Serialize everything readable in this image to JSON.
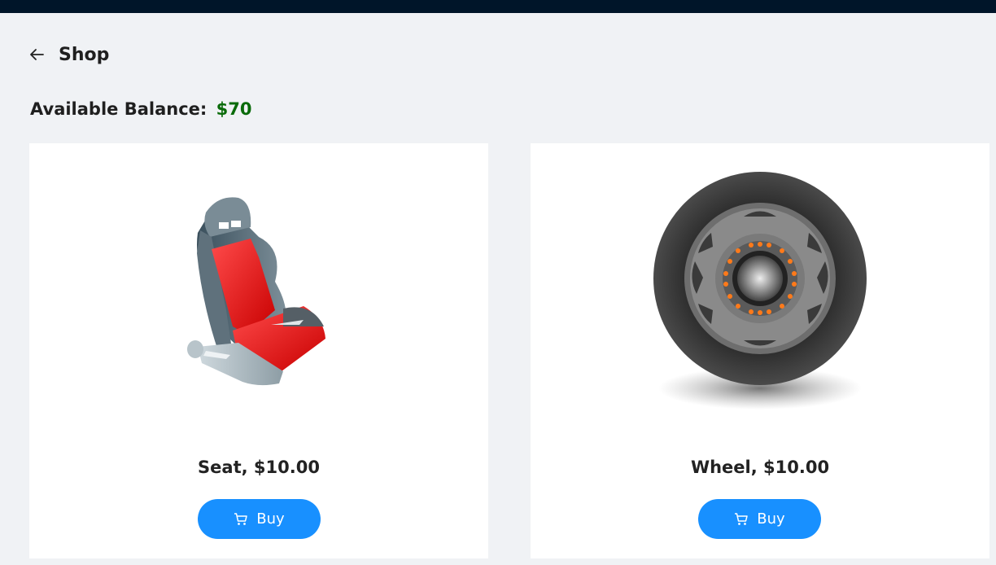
{
  "header": {
    "title": "Shop",
    "back_icon": "arrow-left-icon"
  },
  "balance": {
    "label": "Available Balance:",
    "amount": "$70",
    "amount_color": "#0a6b0a"
  },
  "products": [
    {
      "name": "Seat",
      "price": "$10.00",
      "caption": "Seat, $10.00",
      "buy_label": "Buy",
      "image_icon": "car-seat-image"
    },
    {
      "name": "Wheel",
      "price": "$10.00",
      "caption": "Wheel, $10.00",
      "buy_label": "Buy",
      "image_icon": "wheel-image"
    }
  ],
  "colors": {
    "topbar": "#001529",
    "accent": "#1890ff",
    "background": "#f0f2f5"
  }
}
